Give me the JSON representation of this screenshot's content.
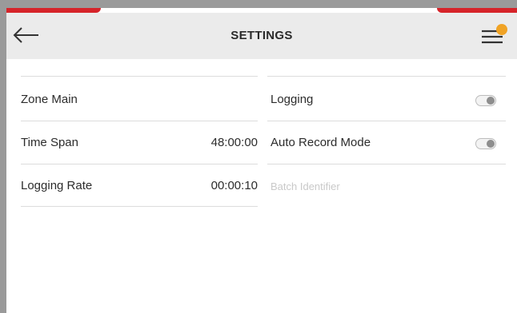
{
  "header": {
    "title": "SETTINGS",
    "back_icon": "back-arrow-icon",
    "menu_icon": "menu-icon",
    "badge_color": "#f0a325"
  },
  "colors": {
    "accent": "#d6242a",
    "header_bg": "#ebebeb",
    "text": "#2c2c2c",
    "placeholder": "#c9c9c9"
  },
  "left_column": {
    "zone_label": "Zone Main",
    "time_span_label": "Time Span",
    "time_span_value": "48:00:00",
    "logging_rate_label": "Logging Rate",
    "logging_rate_value": "00:00:10"
  },
  "right_column": {
    "logging_label": "Logging",
    "logging_on": false,
    "auto_record_label": "Auto Record Mode",
    "auto_record_on": false,
    "batch_placeholder": "Batch Identifier"
  }
}
